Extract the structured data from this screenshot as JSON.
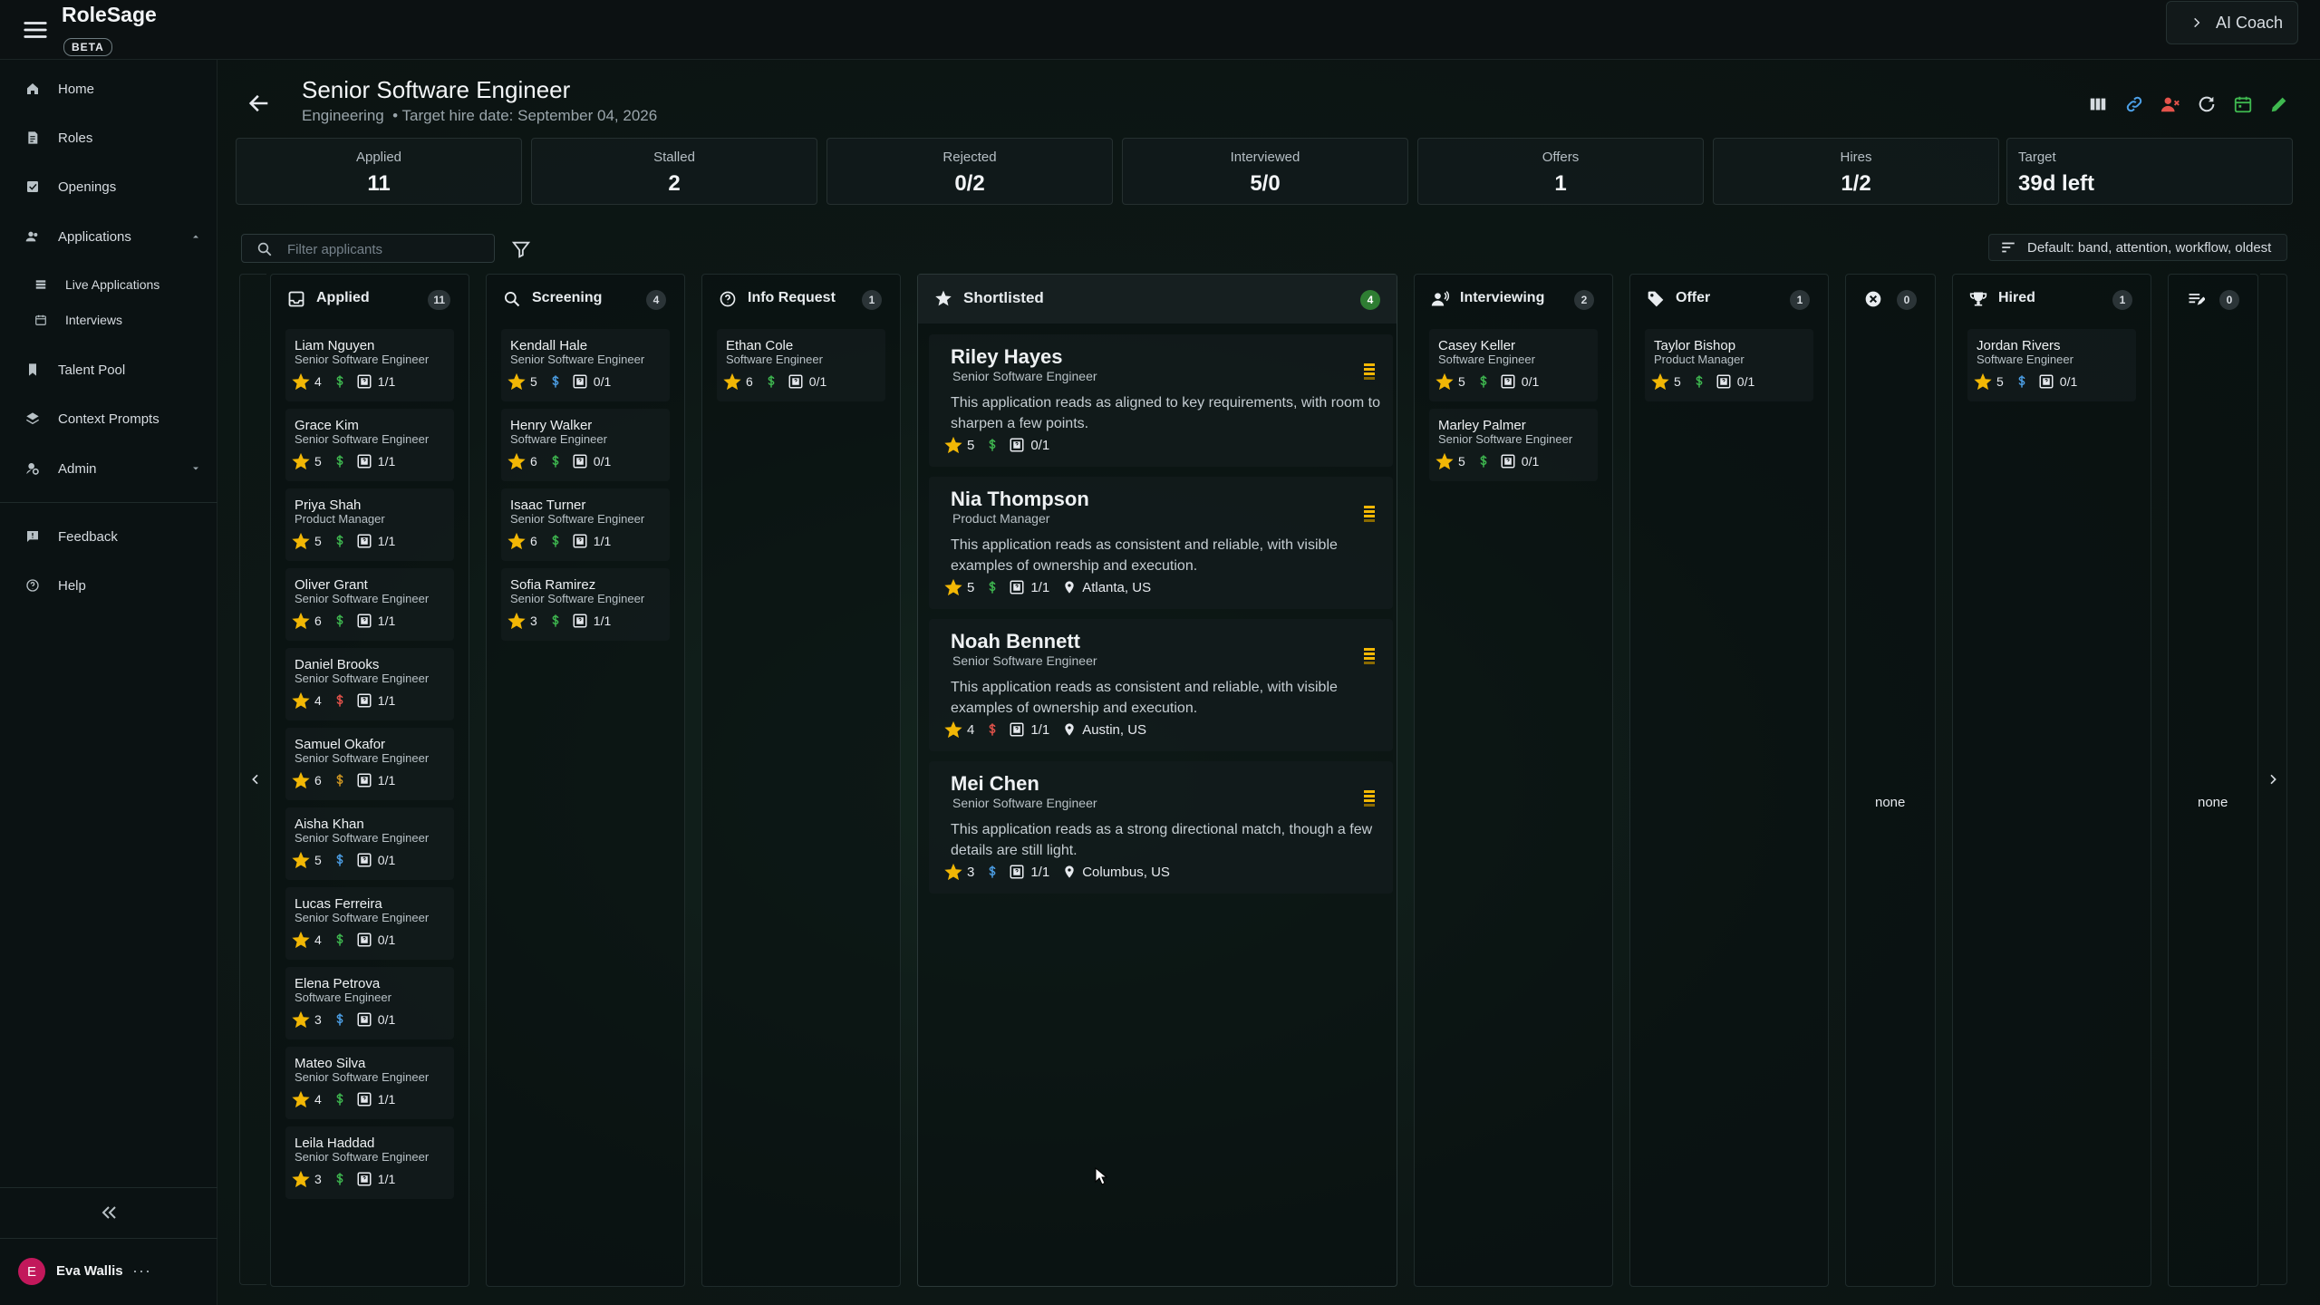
{
  "app": {
    "title": "RoleSage",
    "badge": "BETA"
  },
  "topbar": {
    "ai_coach_label": "AI Coach"
  },
  "sidebar": {
    "items": [
      {
        "label": "Home"
      },
      {
        "label": "Roles"
      },
      {
        "label": "Openings"
      },
      {
        "label": "Applications"
      },
      {
        "label": "Live Applications"
      },
      {
        "label": "Interviews"
      },
      {
        "label": "Talent Pool"
      },
      {
        "label": "Context Prompts"
      },
      {
        "label": "Admin"
      },
      {
        "label": "Feedback"
      },
      {
        "label": "Help"
      }
    ],
    "user": {
      "initial": "E",
      "name": "Eva Wallis",
      "menu": "···"
    }
  },
  "header": {
    "title": "Senior Software Engineer",
    "subtitle": "Engineering  • Target hire date: September 04, 2026"
  },
  "stats": [
    {
      "label": "Applied",
      "value": "11"
    },
    {
      "label": "Stalled",
      "value": "2"
    },
    {
      "label": "Rejected",
      "value": "0/2"
    },
    {
      "label": "Interviewed",
      "value": "5/0"
    },
    {
      "label": "Offers",
      "value": "1"
    },
    {
      "label": "Hires",
      "value": "1/2"
    },
    {
      "label": "Target",
      "value": "39d left"
    }
  ],
  "filter": {
    "placeholder": "Filter applicants"
  },
  "sort": {
    "label": "Default: band, attention, workflow, oldest"
  },
  "columns": {
    "applied": {
      "title": "Applied",
      "count": "11",
      "cards": [
        {
          "name": "Liam Nguyen",
          "role": "Senior Software Engineer",
          "rating": "4",
          "pay": "green",
          "screen": "1/1"
        },
        {
          "name": "Grace Kim",
          "role": "Senior Software Engineer",
          "rating": "5",
          "pay": "green",
          "screen": "1/1"
        },
        {
          "name": "Priya Shah",
          "role": "Product Manager",
          "rating": "5",
          "pay": "green",
          "screen": "1/1"
        },
        {
          "name": "Oliver Grant",
          "role": "Senior Software Engineer",
          "rating": "6",
          "pay": "green",
          "screen": "1/1"
        },
        {
          "name": "Daniel Brooks",
          "role": "Senior Software Engineer",
          "rating": "4",
          "pay": "red",
          "screen": "1/1"
        },
        {
          "name": "Samuel Okafor",
          "role": "Senior Software Engineer",
          "rating": "6",
          "pay": "yellow",
          "screen": "1/1"
        },
        {
          "name": "Aisha Khan",
          "role": "Senior Software Engineer",
          "rating": "5",
          "pay": "blue",
          "screen": "0/1"
        },
        {
          "name": "Lucas Ferreira",
          "role": "Senior Software Engineer",
          "rating": "4",
          "pay": "green",
          "screen": "0/1"
        },
        {
          "name": "Elena Petrova",
          "role": "Software Engineer",
          "rating": "3",
          "pay": "blue",
          "screen": "0/1"
        },
        {
          "name": "Mateo Silva",
          "role": "Senior Software Engineer",
          "rating": "4",
          "pay": "green",
          "screen": "1/1"
        },
        {
          "name": "Leila Haddad",
          "role": "Senior Software Engineer",
          "rating": "3",
          "pay": "green",
          "screen": "1/1"
        }
      ]
    },
    "screening": {
      "title": "Screening",
      "count": "4",
      "cards": [
        {
          "name": "Kendall Hale",
          "role": "Senior Software Engineer",
          "rating": "5",
          "pay": "blue",
          "screen": "0/1"
        },
        {
          "name": "Henry Walker",
          "role": "Software Engineer",
          "rating": "6",
          "pay": "green",
          "screen": "0/1"
        },
        {
          "name": "Isaac Turner",
          "role": "Senior Software Engineer",
          "rating": "6",
          "pay": "green",
          "screen": "1/1"
        },
        {
          "name": "Sofia Ramirez",
          "role": "Senior Software Engineer",
          "rating": "3",
          "pay": "green",
          "screen": "1/1"
        }
      ]
    },
    "info_request": {
      "title": "Info Request",
      "count": "1",
      "cards": [
        {
          "name": "Ethan Cole",
          "role": "Software Engineer",
          "rating": "6",
          "pay": "green",
          "screen": "0/1"
        }
      ]
    },
    "shortlisted": {
      "title": "Shortlisted",
      "count": "4",
      "cards": [
        {
          "name": "Riley Hayes",
          "role": "Senior Software Engineer",
          "desc": "This application reads as aligned to key requirements, with room to sharpen a few points.",
          "rating": "5",
          "pay": "green",
          "screen": "0/1",
          "location": ""
        },
        {
          "name": "Nia Thompson",
          "role": "Product Manager",
          "desc": "This application reads as consistent and reliable, with visible examples of ownership and execution.",
          "rating": "5",
          "pay": "green",
          "screen": "1/1",
          "location": "Atlanta, US"
        },
        {
          "name": "Noah Bennett",
          "role": "Senior Software Engineer",
          "desc": "This application reads as consistent and reliable, with visible examples of ownership and execution.",
          "rating": "4",
          "pay": "red",
          "screen": "1/1",
          "location": "Austin, US"
        },
        {
          "name": "Mei Chen",
          "role": "Senior Software Engineer",
          "desc": "This application reads as a strong directional match, though a few details are still light.",
          "rating": "3",
          "pay": "blue",
          "screen": "1/1",
          "location": "Columbus, US"
        }
      ]
    },
    "interviewing": {
      "title": "Interviewing",
      "count": "2",
      "cards": [
        {
          "name": "Casey Keller",
          "role": "Software Engineer",
          "rating": "5",
          "pay": "green",
          "screen": "0/1"
        },
        {
          "name": "Marley Palmer",
          "role": "Senior Software Engineer",
          "rating": "5",
          "pay": "green",
          "screen": "0/1"
        }
      ]
    },
    "offer": {
      "title": "Offer",
      "count": "1",
      "cards": [
        {
          "name": "Taylor Bishop",
          "role": "Product Manager",
          "rating": "5",
          "pay": "green",
          "screen": "0/1"
        }
      ]
    },
    "rejected": {
      "count": "0",
      "empty": "none"
    },
    "hired": {
      "title": "Hired",
      "count": "1",
      "cards": [
        {
          "name": "Jordan Rivers",
          "role": "Software Engineer",
          "rating": "5",
          "pay": "blue",
          "screen": "0/1"
        }
      ]
    },
    "withdrawn": {
      "count": "0",
      "empty": "none"
    }
  },
  "colors": {
    "accent_green": "#2e7d32",
    "star": "#f2b705",
    "pay_green": "#3fb950",
    "pay_red": "#e5534b",
    "pay_yellow": "#d29922",
    "pay_blue": "#4c9fe6"
  }
}
